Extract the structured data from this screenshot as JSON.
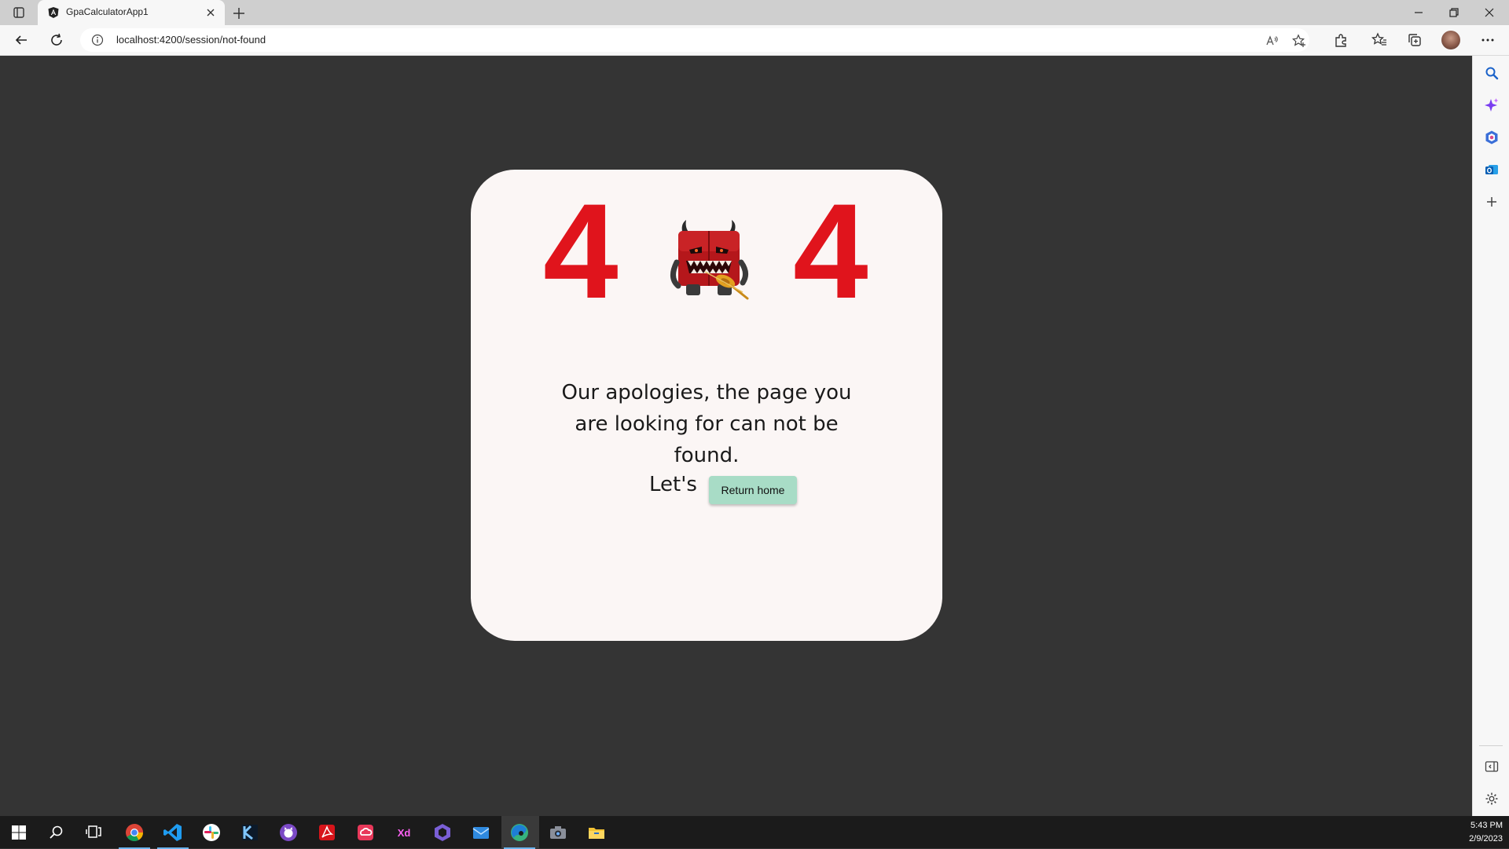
{
  "browser": {
    "tab_title": "GpaCalculatorApp1",
    "url_host": "localhost",
    "url_path": ":4200/session/not-found"
  },
  "page": {
    "digit_left": "4",
    "digit_right": "4",
    "apology_text": "Our apologies, the page you are looking for can not be found.",
    "lets_text": "Let's",
    "return_button_label": "Return home"
  },
  "sidebar": {
    "icons": [
      "search-icon",
      "copilot-icon",
      "office-icon",
      "outlook-icon",
      "add-icon",
      "hide-sidebar-icon",
      "settings-icon"
    ]
  },
  "taskbar": {
    "apps": [
      "windows-start-icon",
      "search-icon",
      "task-view-icon",
      "chrome-icon",
      "vscode-icon",
      "slack-icon",
      "kotlin-icon",
      "github-desktop-icon",
      "acrobat-icon",
      "creative-cloud-icon",
      "adobe-xd-icon",
      "visual-studio-icon",
      "mail-icon",
      "edge-icon",
      "camera-icon",
      "file-explorer-icon"
    ],
    "time": "5:43 PM",
    "date": "2/9/2023"
  },
  "colors": {
    "background": "#343434",
    "card": "#fbf6f5",
    "digit": "#e0141c",
    "button": "#a8dcc6"
  }
}
